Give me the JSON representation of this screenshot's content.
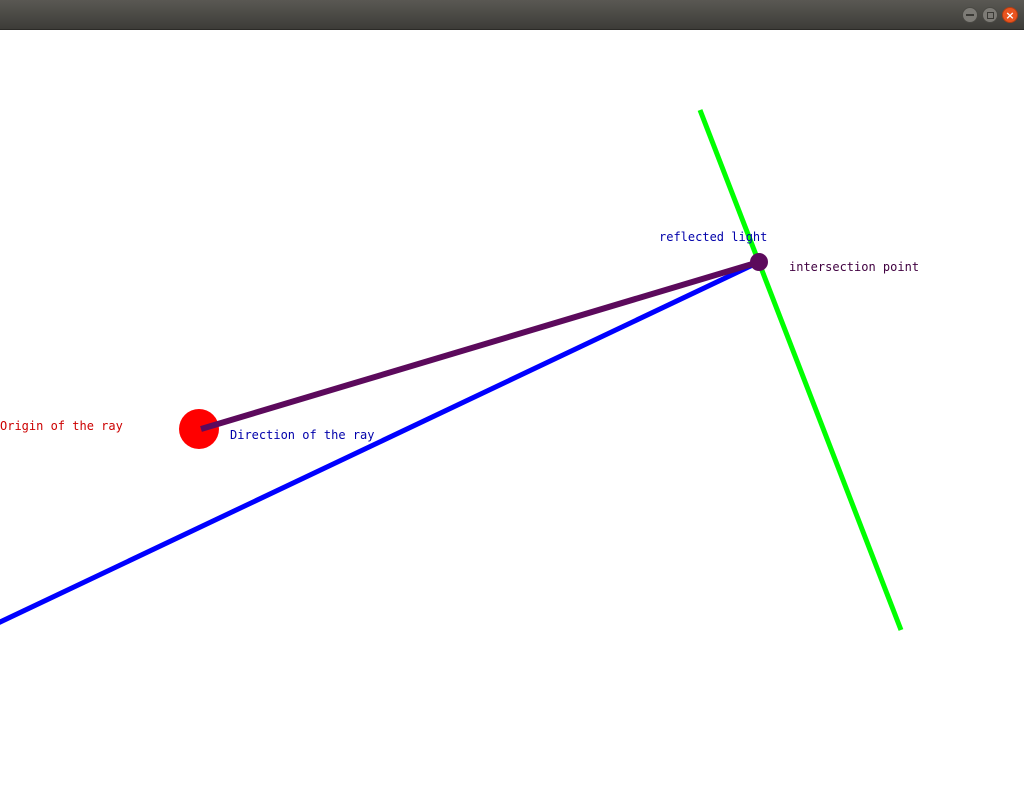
{
  "window": {
    "buttons": {
      "minimize": "minimize-icon",
      "maximize": "maximize-icon",
      "close": "close-icon"
    }
  },
  "scene": {
    "labels": {
      "origin": "Origin of the ray",
      "direction": "Direction of the ray",
      "reflected": "reflected light",
      "intersection": "intersection point"
    },
    "colors": {
      "origin": "#ff0000",
      "origin_label": "#cc0000",
      "direction": "#0000ff",
      "direction_label": "#0000aa",
      "surface": "#00ff00",
      "reflected": "#5c0a5c",
      "intersection_point": "#5c0a5c",
      "intersection_label": "#400040"
    }
  }
}
